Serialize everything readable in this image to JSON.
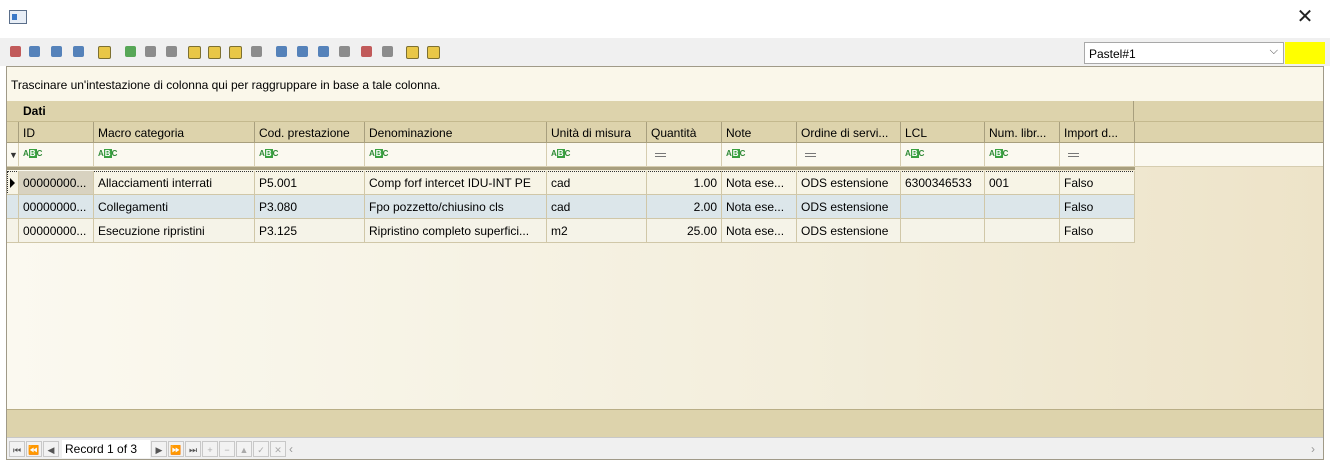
{
  "toolbar": {
    "buttons": [
      "select-icon",
      "zoom-in-icon",
      "zoom-fit-icon",
      "window-icon",
      "align-icon",
      "export-icon",
      "grid-icon",
      "columns-icon",
      "split-icon",
      "db-next-icon",
      "db-prev-icon",
      "db-gray-icon",
      "copy-icon",
      "print-icon",
      "print-preview-icon",
      "filter-icon",
      "layout-icon",
      "expand-icon",
      "help-icon",
      "info-icon"
    ],
    "layout_combo": "Pastel#1",
    "swatch_color": "#ffff00"
  },
  "grid": {
    "group_panel_text": "Trascinare un'intestazione di colonna qui per raggruppare in base a tale colonna.",
    "band_title": "Dati",
    "columns": [
      "ID",
      "Macro categoria",
      "Cod. prestazione",
      "Denominazione",
      "Unità di misura",
      "Quantità",
      "Note",
      "Ordine di servi...",
      "LCL",
      "Num. libr...",
      "Import d..."
    ],
    "filter_types": [
      "text",
      "text",
      "text",
      "text",
      "text",
      "equals",
      "text",
      "equals",
      "text",
      "text",
      "equals"
    ],
    "rows": [
      [
        "00000000...",
        "Allacciamenti interrati",
        "P5.001",
        "Comp forf intercet IDU-INT PE",
        "cad",
        "1.00",
        "Nota ese...",
        "ODS estensione",
        "6300346533",
        "001",
        "Falso"
      ],
      [
        "00000000...",
        "Collegamenti",
        "P3.080",
        "Fpo pozzetto/chiusino cls",
        "cad",
        "2.00",
        "Nota ese...",
        "ODS estensione",
        "",
        "",
        "Falso"
      ],
      [
        "00000000...",
        "Esecuzione ripristini",
        "P3.125",
        "Ripristino completo superfici...",
        "m2",
        "25.00",
        "Nota ese...",
        "ODS estensione",
        "",
        "",
        "Falso"
      ]
    ]
  },
  "navigator": {
    "record_text": "Record 1 of 3"
  }
}
